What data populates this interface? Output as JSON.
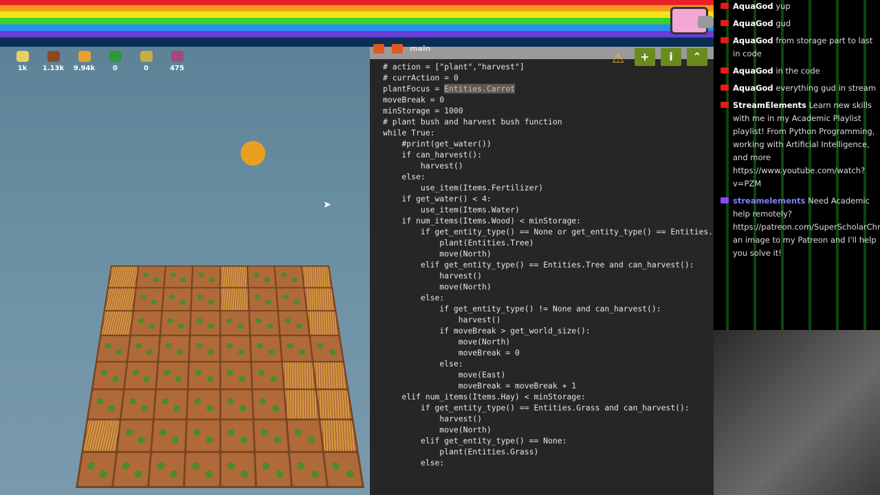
{
  "resources": [
    {
      "name": "hay",
      "value": "1k",
      "color": "#e8d060"
    },
    {
      "name": "wood",
      "value": "1.13k",
      "color": "#8a4a22"
    },
    {
      "name": "carrot",
      "value": "9.94k",
      "color": "#e8a030"
    },
    {
      "name": "water",
      "value": "0",
      "color": "#2a9a3a"
    },
    {
      "name": "fertilizer",
      "value": "0",
      "color": "#c8b040"
    },
    {
      "name": "pumpkin",
      "value": "475",
      "color": "#a04a80"
    }
  ],
  "editor": {
    "title": "main",
    "buttons": {
      "add": "+",
      "info": "i",
      "collapse": "⌃"
    },
    "code": [
      "# action = [\"plant\",\"harvest\"]",
      "# currAction = 0",
      "",
      "plantFocus = Entities.Carrot",
      "moveBreak = 0",
      "minStorage = 1000",
      "# plant bush and harvest bush function",
      "while True:",
      "    #print(get_water())",
      "    if can_harvest():",
      "        harvest()",
      "    else:",
      "        use_item(Items.Fertilizer)",
      "    if get_water() < 4:",
      "        use_item(Items.Water)",
      "",
      "",
      "    if num_items(Items.Wood) < minStorage:",
      "        if get_entity_type() == None or get_entity_type() == Entities.",
      "            plant(Entities.Tree)",
      "            move(North)",
      "        elif get_entity_type() == Entities.Tree and can_harvest():",
      "            harvest()",
      "            move(North)",
      "        else:",
      "            if get_entity_type() != None and can_harvest():",
      "                harvest()",
      "            if moveBreak > get_world_size():",
      "                move(North)",
      "                moveBreak = 0",
      "            else:",
      "                move(East)",
      "                moveBreak = moveBreak + 1",
      "    elif num_items(Items.Hay) < minStorage:",
      "        if get_entity_type() == Entities.Grass and can_harvest():",
      "            harvest()",
      "            move(North)",
      "        elif get_entity_type() == None:",
      "            plant(Entities.Grass)",
      "        else:"
    ]
  },
  "chat": [
    {
      "platform": "youtube",
      "user": "AquaGod",
      "text": "yup"
    },
    {
      "platform": "youtube",
      "user": "AquaGod",
      "text": "gud"
    },
    {
      "platform": "youtube",
      "user": "AquaGod",
      "text": "from storage part to last in code"
    },
    {
      "platform": "youtube",
      "user": "AquaGod",
      "text": "in the code"
    },
    {
      "platform": "youtube",
      "user": "AquaGod",
      "text": "everything gud in stream"
    },
    {
      "platform": "youtube",
      "user": "StreamElements",
      "text": "Learn new skills with me in my Academic Playlist playlist! From Python Programming, working with Artificial Intelligence, and more https://www.youtube.com/watch?v=PZM"
    },
    {
      "platform": "twitch",
      "user": "streamelements",
      "text": "Need Academic help remotely? https://patreon.com/SuperScholarChrisMIASend an image to my Patreon and I'll help you solve it!"
    }
  ]
}
